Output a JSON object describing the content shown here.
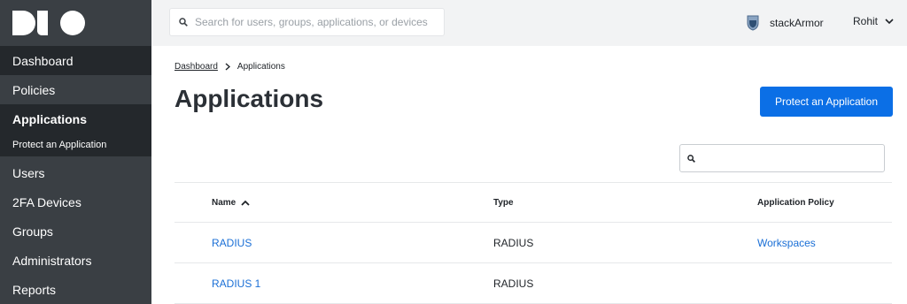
{
  "brand": {
    "logo_text": "DUO"
  },
  "sidebar": {
    "items": [
      {
        "label": "Dashboard"
      },
      {
        "label": "Policies"
      },
      {
        "label": "Applications"
      },
      {
        "label": "Protect an Application"
      },
      {
        "label": "Users"
      },
      {
        "label": "2FA Devices"
      },
      {
        "label": "Groups"
      },
      {
        "label": "Administrators"
      },
      {
        "label": "Reports"
      }
    ]
  },
  "header": {
    "search_placeholder": "Search for users, groups, applications, or devices",
    "org_name": "stackArmor",
    "user_name": "Rohit"
  },
  "breadcrumb": {
    "root": "Dashboard",
    "current": "Applications"
  },
  "page": {
    "title": "Applications",
    "protect_button": "Protect an Application"
  },
  "table": {
    "headers": {
      "name": "Name",
      "type": "Type",
      "policy": "Application Policy"
    },
    "rows": [
      {
        "name": "RADIUS",
        "type": "RADIUS",
        "policy": "Workspaces"
      },
      {
        "name": "RADIUS 1",
        "type": "RADIUS",
        "policy": ""
      }
    ]
  },
  "colors": {
    "accent": "#0b6fe6",
    "link": "#1a6fd6",
    "sidebar": "#3a3f44"
  }
}
